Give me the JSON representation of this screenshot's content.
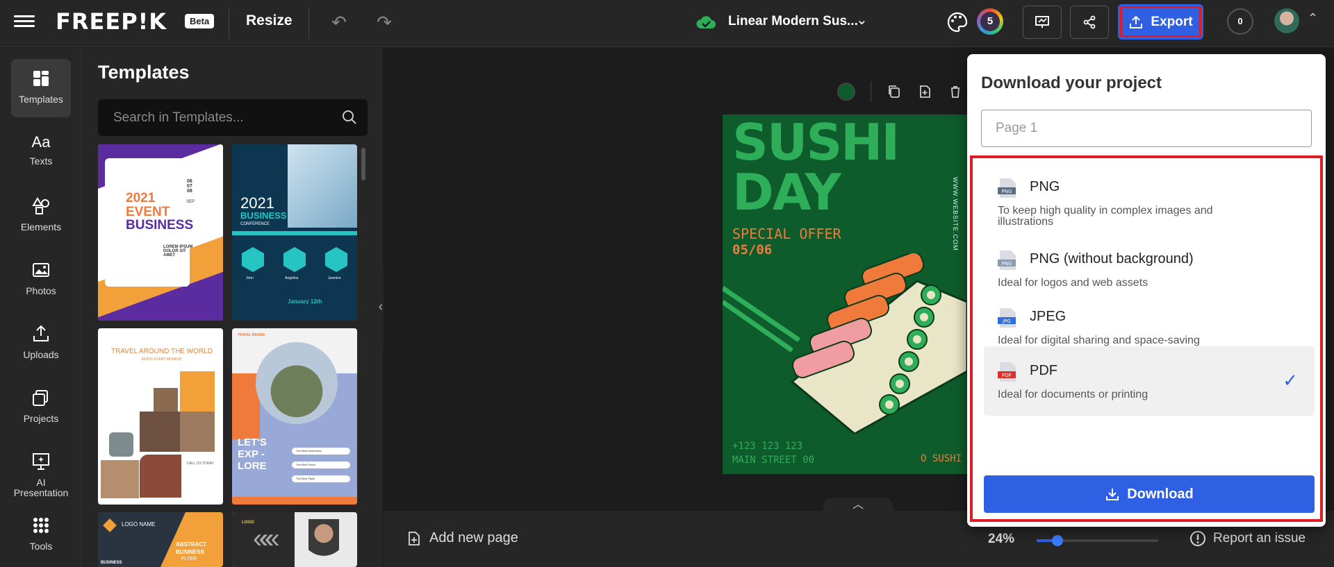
{
  "header": {
    "brand": "FREEP!K",
    "beta_label": "Beta",
    "resize_label": "Resize",
    "doc_title": "Linear Modern Sus...",
    "color_count": "5",
    "export_label": "Export",
    "credits": "0"
  },
  "rail": {
    "items": [
      {
        "label": "Templates"
      },
      {
        "label": "Texts"
      },
      {
        "label": "Elements"
      },
      {
        "label": "Photos"
      },
      {
        "label": "Uploads"
      },
      {
        "label": "Projects"
      },
      {
        "label": "AI Presentation"
      },
      {
        "label": "Tools"
      }
    ]
  },
  "templates_panel": {
    "title": "Templates",
    "search_placeholder": "Search in Templates...",
    "thumbnails": [
      {
        "text1": "2021",
        "text2": "EVENT",
        "text3": "BUSINESS",
        "dates": "06 07 08",
        "month": "SEP",
        "body": "LOREM IPSUM DOLOR SIT AMET"
      },
      {
        "text1": "2021",
        "text2": "BUSINESS",
        "text3": "CONFERENCE",
        "names": [
          "John",
          "Angelina",
          "Jasmine"
        ],
        "footer": "January 12th"
      },
      {
        "text1": "TRAVEL AROUND THE WORLD",
        "text2": "ENJOY EVERY MOMENT",
        "cta": "CALL US TODAY"
      },
      {
        "brand": "TRAVEL BRAND",
        "text1": "LET'S EXP - LORE",
        "rows": [
          "The Best Destination",
          "The Best Prices",
          "The Best Flight"
        ]
      },
      {
        "logo": "LOGO NAME",
        "text1": "ABSTRACT",
        "text2": "BUSINESS",
        "text3": "FLYER",
        "text4": "BUSINESS"
      },
      {
        "logo": "LOGO"
      }
    ]
  },
  "poster": {
    "headline1": "SUSHI",
    "headline2": "DAY",
    "offer": "SPECIAL OFFER",
    "date": "05/06",
    "phone": "+123 123 123",
    "address": "MAIN STREET 00",
    "tag": "O SUSHI",
    "website": "WWW.WEBSITE.COM"
  },
  "bottombar": {
    "add_page_label": "Add new page",
    "zoom_label": "24%",
    "zoom_value": 0.24,
    "report_label": "Report an issue"
  },
  "export_dropdown": {
    "title": "Download your project",
    "page_placeholder": "Page 1",
    "formats": [
      {
        "icon_text": "PNG",
        "name": "PNG",
        "description": "To keep high quality in complex images and illustrations",
        "selected": false
      },
      {
        "icon_text": "PNG",
        "name": "PNG (without background)",
        "description": "Ideal for logos and web assets",
        "selected": false
      },
      {
        "icon_text": "JPG",
        "name": "JPEG",
        "description": "Ideal for digital sharing and space-saving",
        "selected": false
      },
      {
        "icon_text": "PDF",
        "name": "PDF",
        "description": "Ideal for documents or printing",
        "selected": true
      }
    ],
    "download_label": "Download"
  },
  "colors": {
    "accent": "#2f5fe3",
    "highlight": "#e01b24",
    "poster_bg": "#0e5c2c"
  }
}
